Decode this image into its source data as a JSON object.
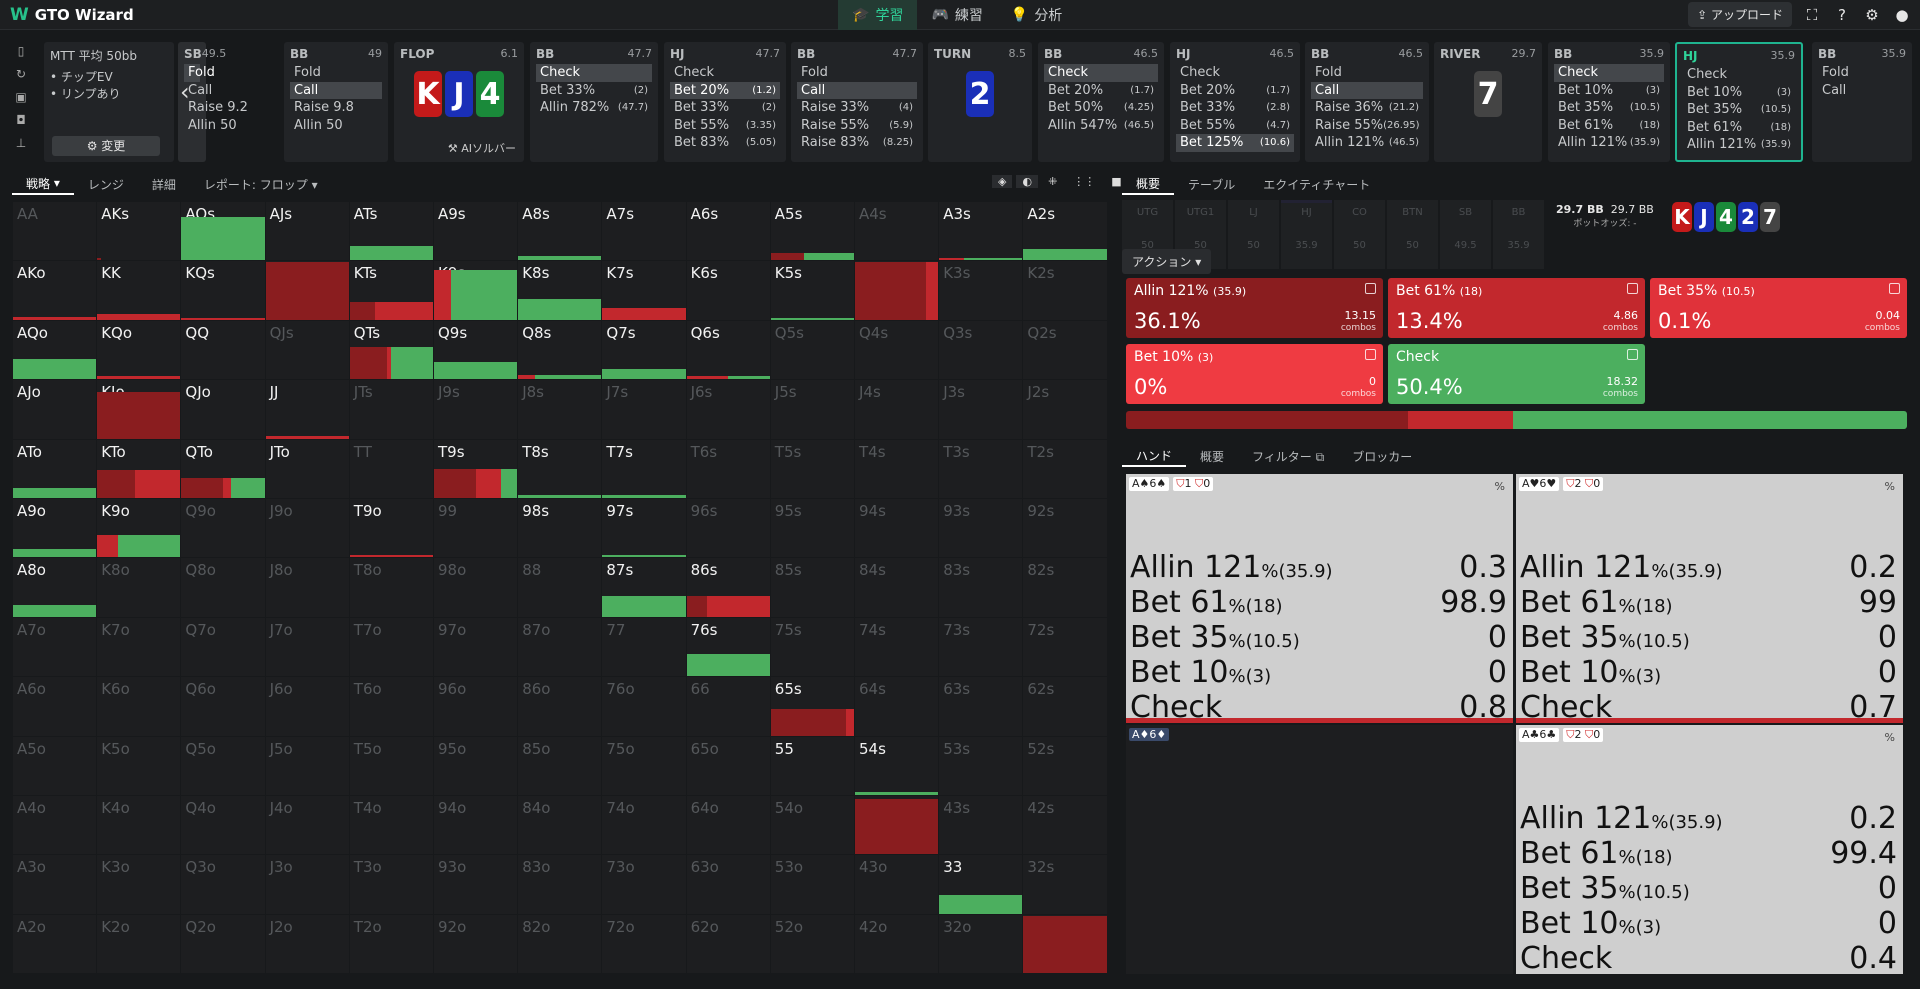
{
  "app": {
    "name": "GTO Wizard"
  },
  "nav": [
    {
      "label": "学習",
      "icon": "school-icon"
    },
    {
      "label": "練習",
      "icon": "gamepad-icon"
    },
    {
      "label": "分析",
      "icon": "bulb-icon"
    }
  ],
  "topright": {
    "upload": "アップロード"
  },
  "game": {
    "title": "MTT 平均 50bb",
    "opt1": "• チップEV",
    "opt2": "• リンプあり",
    "change": "変更"
  },
  "strip": [
    {
      "pos": "SB",
      "num": "49.5",
      "rows": [
        [
          "Fold",
          ""
        ],
        [
          "Call",
          ""
        ],
        [
          "Raise 9.2",
          ""
        ],
        [
          "Allin 50",
          ""
        ]
      ],
      "sel": 0
    },
    {
      "pos": "BB",
      "num": "49",
      "rows": [
        [
          "Fold",
          ""
        ],
        [
          "Call",
          ""
        ],
        [
          "Raise 9.8",
          ""
        ],
        [
          "Allin 50",
          ""
        ]
      ],
      "sel": 1
    },
    {
      "pos": "FLOP",
      "num": "6.1",
      "board": [
        "K",
        "J",
        "4"
      ],
      "extra": "AIソルバー"
    },
    {
      "pos": "BB",
      "num": "47.7",
      "rows": [
        [
          "Check",
          ""
        ],
        [
          "Bet 33%",
          "(2)"
        ],
        [
          "Allin 782%",
          "(47.7)"
        ]
      ],
      "sel": 0
    },
    {
      "pos": "HJ",
      "num": "47.7",
      "rows": [
        [
          "Check",
          ""
        ],
        [
          "Bet 20%",
          "(1.2)"
        ],
        [
          "Bet 33%",
          "(2)"
        ],
        [
          "Bet 55%",
          "(3.35)"
        ],
        [
          "Bet 83%",
          "(5.05)"
        ]
      ],
      "sel": 1
    },
    {
      "pos": "BB",
      "num": "47.7",
      "rows": [
        [
          "Fold",
          ""
        ],
        [
          "Call",
          ""
        ],
        [
          "Raise 33%",
          "(4)"
        ],
        [
          "Raise 55%",
          "(5.9)"
        ],
        [
          "Raise 83%",
          "(8.25)"
        ]
      ],
      "sel": 1
    },
    {
      "pos": "TURN",
      "num": "8.5",
      "board": [
        "2"
      ]
    },
    {
      "pos": "BB",
      "num": "46.5",
      "rows": [
        [
          "Check",
          ""
        ],
        [
          "Bet 20%",
          "(1.7)"
        ],
        [
          "Bet 50%",
          "(4.25)"
        ],
        [
          "Allin 547%",
          "(46.5)"
        ]
      ],
      "sel": 0
    },
    {
      "pos": "HJ",
      "num": "46.5",
      "rows": [
        [
          "Check",
          ""
        ],
        [
          "Bet 20%",
          "(1.7)"
        ],
        [
          "Bet 33%",
          "(2.8)"
        ],
        [
          "Bet 55%",
          "(4.7)"
        ],
        [
          "Bet 125%",
          "(10.6)"
        ]
      ],
      "sel": 4
    },
    {
      "pos": "BB",
      "num": "46.5",
      "rows": [
        [
          "Fold",
          ""
        ],
        [
          "Call",
          ""
        ],
        [
          "Raise 36%",
          "(21.2)"
        ],
        [
          "Raise 55%",
          "(26.95)"
        ],
        [
          "Allin 121%",
          "(46.5)"
        ]
      ],
      "sel": 1
    },
    {
      "pos": "RIVER",
      "num": "29.7",
      "board": [
        "7"
      ]
    },
    {
      "pos": "BB",
      "num": "35.9",
      "rows": [
        [
          "Check",
          ""
        ],
        [
          "Bet 10%",
          "(3)"
        ],
        [
          "Bet 35%",
          "(10.5)"
        ],
        [
          "Bet 61%",
          "(18)"
        ],
        [
          "Allin 121%",
          "(35.9)"
        ]
      ],
      "sel": 0
    },
    {
      "pos": "HJ",
      "num": "35.9",
      "rows": [
        [
          "Check",
          ""
        ],
        [
          "Bet 10%",
          "(3)"
        ],
        [
          "Bet 35%",
          "(10.5)"
        ],
        [
          "Bet 61%",
          "(18)"
        ],
        [
          "Allin 121%",
          "(35.9)"
        ]
      ],
      "sel": -1,
      "hl": true
    },
    {
      "pos": "BB",
      "num": "35.9",
      "rows": [
        [
          "Fold",
          ""
        ],
        [
          "Call",
          ""
        ]
      ],
      "sel": -1
    }
  ],
  "lefttabs": [
    "戦略",
    "レンジ",
    "詳細",
    "レポート: フロップ"
  ],
  "righttabs": [
    "概要",
    "テーブル",
    "エクイティチャート"
  ],
  "positions": [
    [
      "UTG",
      "50"
    ],
    [
      "UTG1",
      "50"
    ],
    [
      "LJ",
      "50"
    ],
    [
      "HJ",
      "35.9"
    ],
    [
      "CO",
      "50"
    ],
    [
      "BTN",
      "50"
    ],
    [
      "SB",
      "49.5"
    ],
    [
      "BB",
      "35.9"
    ]
  ],
  "pot": {
    "a": "29.7 BB",
    "b": "29.7 BB",
    "odds": "ポットオッズ: -",
    "board": [
      "K",
      "J",
      "4",
      "2",
      "7"
    ]
  },
  "actions_label": "アクション",
  "actions": [
    {
      "name": "Allin 121%",
      "size": "(35.9)",
      "pct": "36.1%",
      "combos": "13.15",
      "color": "#8a1d1f"
    },
    {
      "name": "Bet 61%",
      "size": "(18)",
      "pct": "13.4%",
      "combos": "4.86",
      "color": "#c2282d"
    },
    {
      "name": "Bet 35%",
      "size": "(10.5)",
      "pct": "0.1%",
      "combos": "0.04",
      "color": "#e0323a"
    },
    {
      "name": "Bet 10%",
      "size": "(3)",
      "pct": "0%",
      "combos": "0",
      "color": "#ef3b42"
    },
    {
      "name": "Check",
      "size": "",
      "pct": "50.4%",
      "combos": "18.32",
      "color": "#4caf5f"
    }
  ],
  "combos_word": "combos",
  "handtabs": [
    "ハンド",
    "概要",
    "フィルター",
    "ブロッカー"
  ],
  "hands": [
    {
      "cards": "A♠6♠",
      "b1": "1",
      "b2": "0",
      "vals": [
        "0.3",
        "98.9",
        "0",
        "0",
        "0.8"
      ]
    },
    {
      "cards": "A♥6♥",
      "b1": "2",
      "b2": "0",
      "vals": [
        "0.2",
        "99",
        "0",
        "0",
        "0.7"
      ]
    },
    {
      "cards": "A♦6♦",
      "b1": "",
      "b2": "",
      "vals": []
    },
    {
      "cards": "A♣6♣",
      "b1": "2",
      "b2": "0",
      "vals": [
        "0.2",
        "99.4",
        "0",
        "0",
        "0.4"
      ]
    }
  ],
  "hand_actions": [
    [
      "Allin 121",
      "(35.9)"
    ],
    [
      "Bet 61",
      "(18)"
    ],
    [
      "Bet 35",
      "(10.5)"
    ],
    [
      "Bet 10",
      "(3)"
    ],
    [
      "Check",
      ""
    ]
  ],
  "matrix": [
    [
      "AA",
      "AKs",
      "AQs",
      "AJs",
      "ATs",
      "A9s",
      "A8s",
      "A7s",
      "A6s",
      "A5s",
      "A4s",
      "A3s",
      "A2s"
    ],
    [
      "AKo",
      "KK",
      "KQs",
      "KJs",
      "KTs",
      "K9s",
      "K8s",
      "K7s",
      "K6s",
      "K5s",
      "K4s",
      "K3s",
      "K2s"
    ],
    [
      "AQo",
      "KQo",
      "QQ",
      "QJs",
      "QTs",
      "Q9s",
      "Q8s",
      "Q7s",
      "Q6s",
      "Q5s",
      "Q4s",
      "Q3s",
      "Q2s"
    ],
    [
      "AJo",
      "KJo",
      "QJo",
      "JJ",
      "JTs",
      "J9s",
      "J8s",
      "J7s",
      "J6s",
      "J5s",
      "J4s",
      "J3s",
      "J2s"
    ],
    [
      "ATo",
      "KTo",
      "QTo",
      "JTo",
      "TT",
      "T9s",
      "T8s",
      "T7s",
      "T6s",
      "T5s",
      "T4s",
      "T3s",
      "T2s"
    ],
    [
      "A9o",
      "K9o",
      "Q9o",
      "J9o",
      "T9o",
      "99",
      "98s",
      "97s",
      "96s",
      "95s",
      "94s",
      "93s",
      "92s"
    ],
    [
      "A8o",
      "K8o",
      "Q8o",
      "J8o",
      "T8o",
      "98o",
      "88",
      "87s",
      "86s",
      "85s",
      "84s",
      "83s",
      "82s"
    ],
    [
      "A7o",
      "K7o",
      "Q7o",
      "J7o",
      "T7o",
      "97o",
      "87o",
      "77",
      "76s",
      "75s",
      "74s",
      "73s",
      "72s"
    ],
    [
      "A6o",
      "K6o",
      "Q6o",
      "J6o",
      "T6o",
      "96o",
      "86o",
      "76o",
      "66",
      "65s",
      "64s",
      "63s",
      "62s"
    ],
    [
      "A5o",
      "K5o",
      "Q5o",
      "J5o",
      "T5o",
      "95o",
      "85o",
      "75o",
      "65o",
      "55",
      "54s",
      "53s",
      "52s"
    ],
    [
      "A4o",
      "K4o",
      "Q4o",
      "J4o",
      "T4o",
      "94o",
      "84o",
      "74o",
      "64o",
      "54o",
      "44",
      "43s",
      "42s"
    ],
    [
      "A3o",
      "K3o",
      "Q3o",
      "J3o",
      "T3o",
      "93o",
      "83o",
      "73o",
      "63o",
      "53o",
      "43o",
      "33",
      "32s"
    ],
    [
      "A2o",
      "K2o",
      "Q2o",
      "J2o",
      "T2o",
      "92o",
      "82o",
      "72o",
      "62o",
      "52o",
      "42o",
      "32o",
      "22"
    ]
  ],
  "active": [
    "AKs",
    "AQs",
    "AJs",
    "ATs",
    "A9s",
    "A8s",
    "A7s",
    "A6s",
    "A5s",
    "A3s",
    "A2s",
    "AKo",
    "KK",
    "KQs",
    "KJs",
    "KTs",
    "K9s",
    "K8s",
    "K7s",
    "K6s",
    "K5s",
    "K4s",
    "AQo",
    "KQo",
    "QQ",
    "QTs",
    "Q9s",
    "Q8s",
    "Q7s",
    "Q6s",
    "AJo",
    "KJo",
    "QJo",
    "JJ",
    "ATo",
    "KTo",
    "QTo",
    "JTo",
    "T9s",
    "T8s",
    "T7s",
    "A9o",
    "K9o",
    "T9o",
    "98s",
    "97s",
    "A8o",
    "87s",
    "86s",
    "76s",
    "65s",
    "55",
    "54s",
    "44",
    "33",
    "22"
  ],
  "fills": {
    "AKs": [
      [
        0.05,
        "#8a1d1f",
        0.05
      ]
    ],
    "AQs": [
      [
        1,
        "#4caf5f",
        0.75
      ]
    ],
    "ATs": [
      [
        1,
        "#4caf5f",
        0.25
      ]
    ],
    "A8s": [
      [
        1,
        "#4caf5f",
        0.08
      ]
    ],
    "A5s": [
      [
        0.4,
        "#8a1d1f",
        0.12
      ],
      [
        0.6,
        "#4caf5f",
        0.12
      ]
    ],
    "A3s": [
      [
        0.3,
        "#c2282d",
        0.04
      ],
      [
        0.7,
        "#4caf5f",
        0.04
      ]
    ],
    "A2s": [
      [
        1,
        "#4caf5f",
        0.2
      ]
    ],
    "AKo": [
      [
        1,
        "#c2282d",
        0.04
      ]
    ],
    "KK": [
      [
        1,
        "#c2282d",
        0.1
      ]
    ],
    "KQs": [
      [
        1,
        "#c2282d",
        0.03
      ]
    ],
    "KJs": [
      [
        1,
        "#8a1d1f",
        1
      ]
    ],
    "KTs": [
      [
        0.3,
        "#8a1d1f",
        0.3
      ],
      [
        0.7,
        "#c2282d",
        0.3
      ]
    ],
    "K9s": [
      [
        0.2,
        "#c2282d",
        0.85
      ],
      [
        0.8,
        "#4caf5f",
        0.85
      ]
    ],
    "K8s": [
      [
        1,
        "#4caf5f",
        0.35
      ]
    ],
    "K7s": [
      [
        1,
        "#c2282d",
        0.2
      ]
    ],
    "K5s": [
      [
        1,
        "#4caf5f",
        0.03
      ]
    ],
    "K4s": [
      [
        0.85,
        "#8a1d1f",
        1
      ],
      [
        0.15,
        "#c2282d",
        1
      ]
    ],
    "AQo": [
      [
        1,
        "#4caf5f",
        0.35
      ]
    ],
    "KQo": [
      [
        1,
        "#c2282d",
        0.06
      ]
    ],
    "QTs": [
      [
        0.45,
        "#8a1d1f",
        0.55
      ],
      [
        0.05,
        "#c2282d",
        0.55
      ],
      [
        0.5,
        "#4caf5f",
        0.55
      ]
    ],
    "Q9s": [
      [
        1,
        "#4caf5f",
        0.3
      ]
    ],
    "Q8s": [
      [
        0.2,
        "#c2282d",
        0.08
      ],
      [
        0.8,
        "#4caf5f",
        0.08
      ]
    ],
    "Q7s": [
      [
        1,
        "#4caf5f",
        0.18
      ]
    ],
    "Q6s": [
      [
        0.5,
        "#c2282d",
        0.05
      ],
      [
        0.5,
        "#4caf5f",
        0.05
      ]
    ],
    "KJo": [
      [
        1,
        "#8a1d1f",
        0.8
      ]
    ],
    "JJ": [
      [
        1,
        "#c2282d",
        0.04
      ]
    ],
    "ATo": [
      [
        1,
        "#4caf5f",
        0.18
      ]
    ],
    "KTo": [
      [
        0.45,
        "#8a1d1f",
        0.48
      ],
      [
        0.55,
        "#c2282d",
        0.48
      ]
    ],
    "QTo": [
      [
        0.5,
        "#8a1d1f",
        0.35
      ],
      [
        0.1,
        "#c2282d",
        0.35
      ],
      [
        0.4,
        "#4caf5f",
        0.35
      ]
    ],
    "T9s": [
      [
        0.5,
        "#8a1d1f",
        0.5
      ],
      [
        0.3,
        "#c2282d",
        0.5
      ],
      [
        0.2,
        "#4caf5f",
        0.5
      ]
    ],
    "T8s": [
      [
        1,
        "#4caf5f",
        0.05
      ]
    ],
    "T7s": [
      [
        1,
        "#4caf5f",
        0.06
      ]
    ],
    "A9o": [
      [
        1,
        "#4caf5f",
        0.15
      ]
    ],
    "K9o": [
      [
        0.25,
        "#c2282d",
        0.38
      ],
      [
        0.75,
        "#4caf5f",
        0.38
      ]
    ],
    "T9o": [
      [
        1,
        "#c2282d",
        0.05
      ]
    ],
    "97s": [
      [
        1,
        "#4caf5f",
        0.04
      ]
    ],
    "A8o": [
      [
        1,
        "#4caf5f",
        0.2
      ]
    ],
    "87s": [
      [
        1,
        "#4caf5f",
        0.35
      ]
    ],
    "86s": [
      [
        0.25,
        "#8a1d1f",
        0.35
      ],
      [
        0.75,
        "#c2282d",
        0.35
      ]
    ],
    "76s": [
      [
        1,
        "#4caf5f",
        0.38
      ]
    ],
    "65s": [
      [
        0.9,
        "#8a1d1f",
        0.45
      ],
      [
        0.1,
        "#c2282d",
        0.45
      ]
    ],
    "54s": [
      [
        1,
        "#4caf5f",
        0.06
      ]
    ],
    "44": [
      [
        1,
        "#8a1d1f",
        0.95
      ]
    ],
    "33": [
      [
        1,
        "#4caf5f",
        0.32
      ]
    ],
    "22": [
      [
        1,
        "#8a1d1f",
        0.98
      ]
    ]
  }
}
